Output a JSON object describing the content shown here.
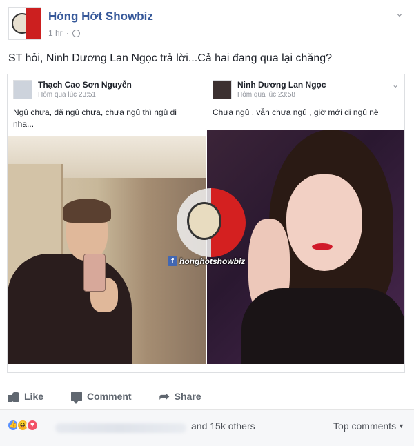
{
  "post": {
    "page_name": "Hóng Hớt Showbiz",
    "timestamp": "1 hr",
    "privacy_icon": "globe-icon",
    "text": "ST hỏi, Ninh Dương Lan Ngọc trả lời...Cả hai đang qua lại chăng?"
  },
  "panels": [
    {
      "name": "Thạch Cao Sơn Nguyễn",
      "time": "Hôm qua lúc 23:51",
      "text": "Ngủ chưa, đã ngủ chưa, chưa ngủ thì ngủ đi nha..."
    },
    {
      "name": "Ninh Dương Lan Ngọc",
      "time": "Hôm qua lúc 23:58",
      "text": "Chưa ngủ , vẫn chưa ngủ , giờ mới đi ngủ nè"
    }
  ],
  "watermark": {
    "text": "honghotshowbiz"
  },
  "actions": {
    "like_label": "Like",
    "comment_label": "Comment",
    "share_label": "Share"
  },
  "reactions": {
    "count_text": "and 15k others",
    "sort_label": "Top comments"
  },
  "colors": {
    "brand_link": "#365899",
    "action_gray": "#606770",
    "like_blue": "#5890ff",
    "haha_yellow": "#f7b125",
    "love_red": "#f25268"
  }
}
